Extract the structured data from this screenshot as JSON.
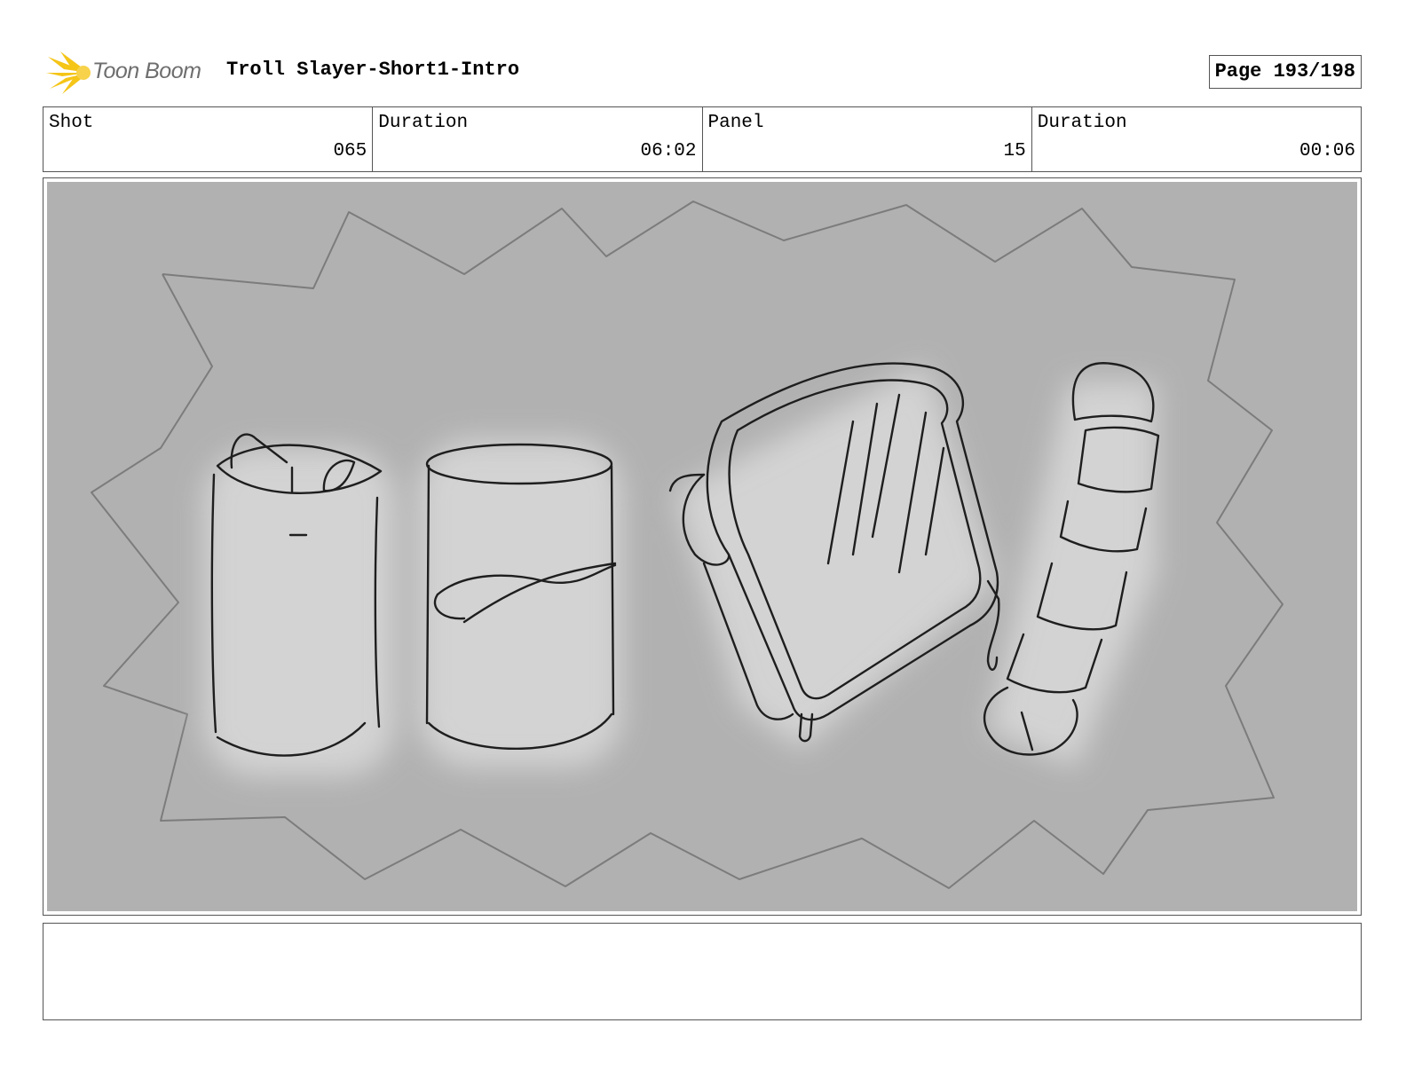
{
  "header": {
    "logo_text": "Toon Boom",
    "title": "Troll Slayer-Short1-Intro",
    "page_label": "Page 193/198"
  },
  "info": {
    "shot_label": "Shot",
    "shot_value": "065",
    "shot_duration_label": "Duration",
    "shot_duration_value": "06:02",
    "panel_label": "Panel",
    "panel_value": "15",
    "panel_duration_label": "Duration",
    "panel_duration_value": "00:06"
  },
  "notes": {
    "text": ""
  },
  "colors": {
    "panel_background": "#b1b1b1",
    "logo_flame": "#f5c518",
    "logo_text": "#6e6e6e"
  },
  "icons": [
    "toon-boom-flame-icon"
  ]
}
